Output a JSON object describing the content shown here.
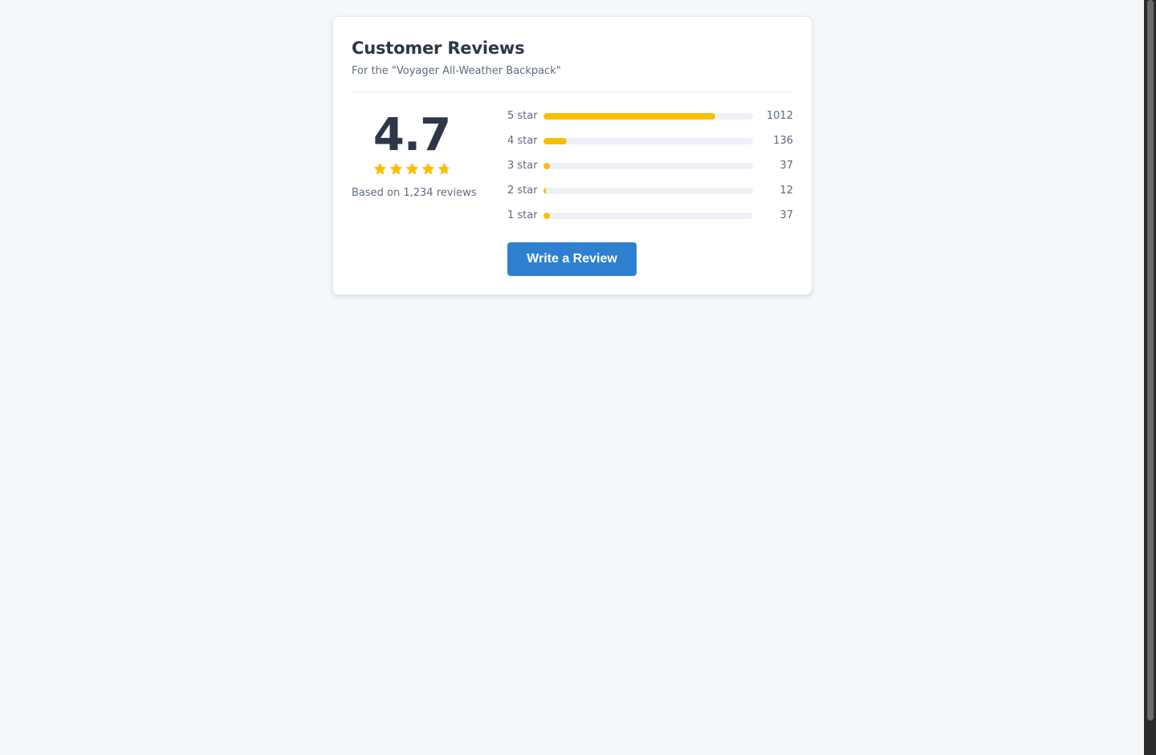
{
  "reviews": {
    "title": "Customer Reviews",
    "subtitle": "For the \"Voyager All-Weather Backpack\"",
    "average": "4.7",
    "average_value": 4.7,
    "max_stars": 5,
    "based_on": "Based on 1,234 reviews",
    "total_reviews": 1234,
    "breakdown": [
      {
        "label": "5 star",
        "count": "1012",
        "fraction": 0.82
      },
      {
        "label": "4 star",
        "count": "136",
        "fraction": 0.11
      },
      {
        "label": "3 star",
        "count": "37",
        "fraction": 0.03
      },
      {
        "label": "2 star",
        "count": "12",
        "fraction": 0.01
      },
      {
        "label": "1 star",
        "count": "37",
        "fraction": 0.03
      }
    ],
    "write_button": "Write a Review"
  },
  "colors": {
    "background": "#f5f8fb",
    "card": "#ffffff",
    "heading": "#2d3748",
    "muted_text": "#5c6b80",
    "star": "#f9be00",
    "track": "#edf1f5",
    "button": "#2f80d1",
    "button_text": "#ffffff"
  },
  "icons": {
    "star": "star-icon",
    "half_star": "star-half-icon"
  }
}
